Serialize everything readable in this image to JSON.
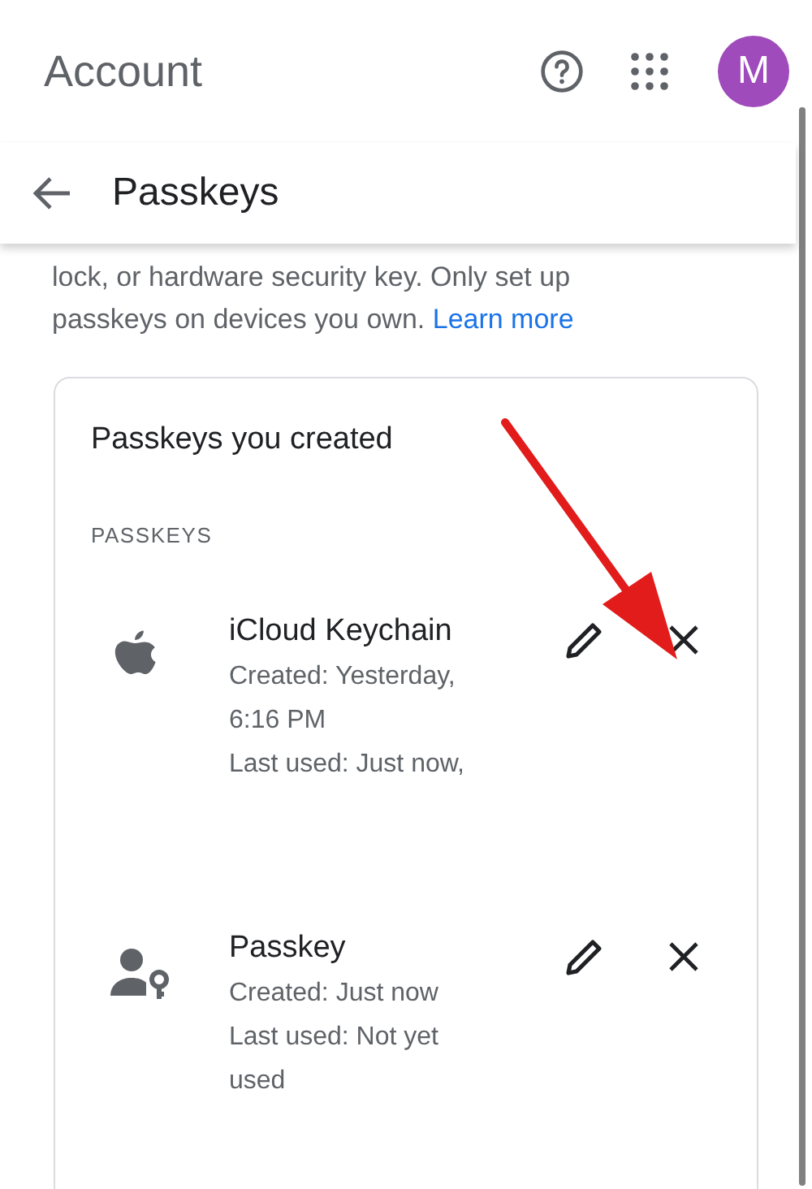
{
  "app_bar": {
    "title": "Account",
    "avatar_letter": "M"
  },
  "page_header": {
    "title": "Passkeys"
  },
  "description": {
    "text": "lock, or hardware security key. Only set up passkeys on devices you own.",
    "link": "Learn more"
  },
  "card": {
    "title": "Passkeys you created",
    "section_label": "PASSKEYS",
    "passkeys": [
      {
        "kind": "apple",
        "name": "iCloud Keychain",
        "details": [
          "Created: Yesterday, 6:16 PM",
          "Last used: Just now,"
        ]
      },
      {
        "kind": "person-key",
        "name": "Passkey",
        "details": [
          "Created: Just now",
          "Last used: Not yet used"
        ]
      }
    ]
  }
}
